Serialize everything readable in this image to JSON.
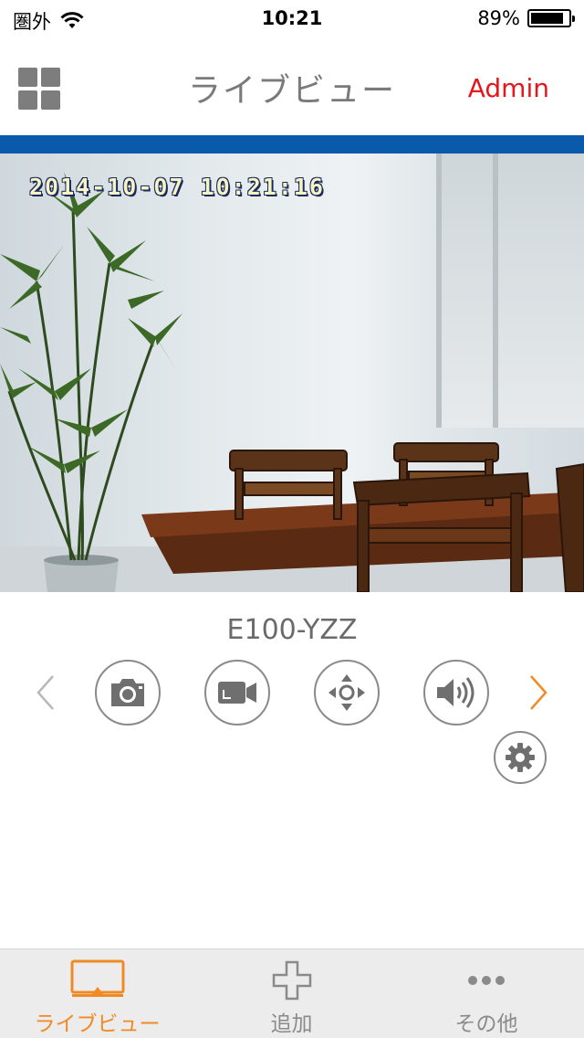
{
  "status_bar": {
    "carrier": "圏外",
    "time": "10:21",
    "battery_text": "89%",
    "battery_level": 0.89
  },
  "nav": {
    "title": "ライブビュー",
    "admin_label": "Admin"
  },
  "camera": {
    "timestamp": "2014-10-07  10:21:16",
    "device_name": "E100-YZZ"
  },
  "controls": {
    "icons": [
      "chevron-left-icon",
      "camera-icon",
      "video-camera-icon",
      "pan-tilt-icon",
      "speaker-icon",
      "chevron-right-icon",
      "gear-icon"
    ]
  },
  "tabs": [
    {
      "label": "ライブビュー",
      "icon": "monitor-icon",
      "active": true
    },
    {
      "label": "追加",
      "icon": "plus-icon",
      "active": false
    },
    {
      "label": "その他",
      "icon": "more-icon",
      "active": false
    }
  ],
  "colors": {
    "accent": "#f08a24",
    "admin": "#e8161c",
    "blue_bar": "#0a5aab",
    "icon_gray": "#7d7d7d"
  }
}
